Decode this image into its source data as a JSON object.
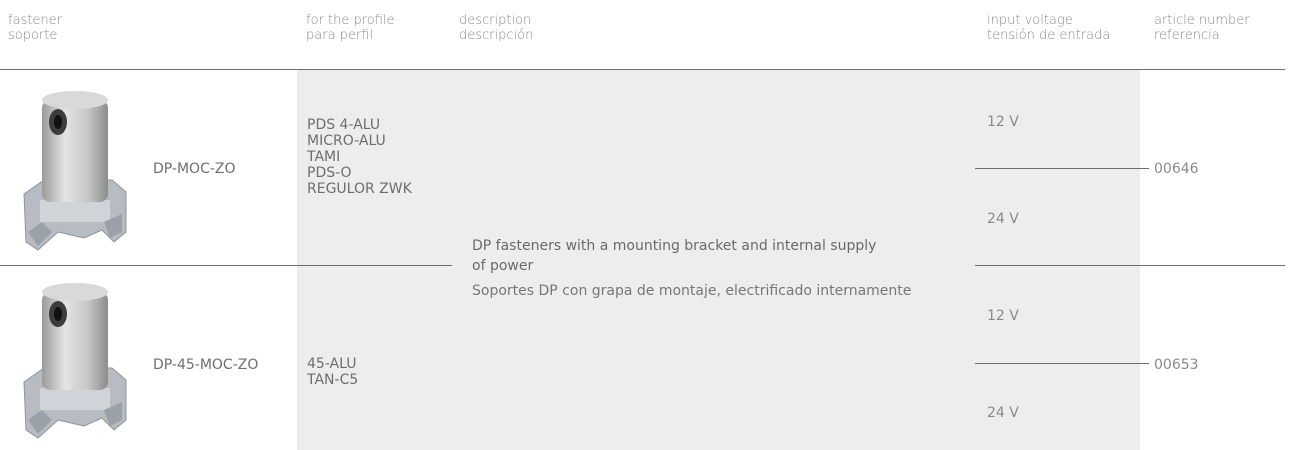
{
  "headers": {
    "fastener": "fastener",
    "fastener_es": "soporte",
    "profile": "for the profile",
    "profile_es": "para perfil",
    "description": "description",
    "description_es": "descripción",
    "voltage": "input voltage",
    "voltage_es": "tensión de entrada",
    "article": "article number",
    "article_es": "referencia"
  },
  "description": {
    "en_line1": "DP fasteners with a mounting bracket and internal supply",
    "en_line2": "of power",
    "es": "Soportes DP con grapa de montaje, electrificado internamente"
  },
  "products": [
    {
      "model": "DP-MOC-ZO",
      "profiles": [
        "PDS 4-ALU",
        "MICRO-ALU",
        "TAMI",
        "PDS-O",
        "REGULOR ZWK"
      ],
      "voltages": [
        "12 V",
        "24 V"
      ],
      "article": "00646"
    },
    {
      "model": "DP-45-MOC-ZO",
      "profiles": [
        "45-ALU",
        "TAN-C5"
      ],
      "voltages": [
        "12 V",
        "24 V"
      ],
      "article": "00653"
    }
  ]
}
